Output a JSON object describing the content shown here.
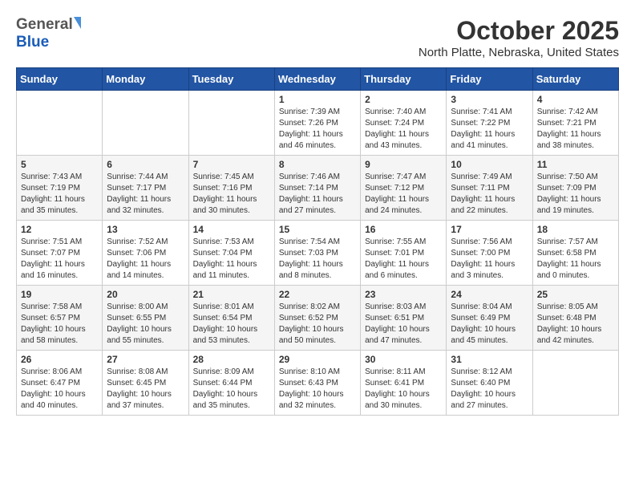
{
  "header": {
    "logo_general": "General",
    "logo_blue": "Blue",
    "title": "October 2025",
    "subtitle": "North Platte, Nebraska, United States"
  },
  "weekdays": [
    "Sunday",
    "Monday",
    "Tuesday",
    "Wednesday",
    "Thursday",
    "Friday",
    "Saturday"
  ],
  "weeks": [
    [
      {
        "day": "",
        "info": ""
      },
      {
        "day": "",
        "info": ""
      },
      {
        "day": "",
        "info": ""
      },
      {
        "day": "1",
        "info": "Sunrise: 7:39 AM\nSunset: 7:26 PM\nDaylight: 11 hours\nand 46 minutes."
      },
      {
        "day": "2",
        "info": "Sunrise: 7:40 AM\nSunset: 7:24 PM\nDaylight: 11 hours\nand 43 minutes."
      },
      {
        "day": "3",
        "info": "Sunrise: 7:41 AM\nSunset: 7:22 PM\nDaylight: 11 hours\nand 41 minutes."
      },
      {
        "day": "4",
        "info": "Sunrise: 7:42 AM\nSunset: 7:21 PM\nDaylight: 11 hours\nand 38 minutes."
      }
    ],
    [
      {
        "day": "5",
        "info": "Sunrise: 7:43 AM\nSunset: 7:19 PM\nDaylight: 11 hours\nand 35 minutes."
      },
      {
        "day": "6",
        "info": "Sunrise: 7:44 AM\nSunset: 7:17 PM\nDaylight: 11 hours\nand 32 minutes."
      },
      {
        "day": "7",
        "info": "Sunrise: 7:45 AM\nSunset: 7:16 PM\nDaylight: 11 hours\nand 30 minutes."
      },
      {
        "day": "8",
        "info": "Sunrise: 7:46 AM\nSunset: 7:14 PM\nDaylight: 11 hours\nand 27 minutes."
      },
      {
        "day": "9",
        "info": "Sunrise: 7:47 AM\nSunset: 7:12 PM\nDaylight: 11 hours\nand 24 minutes."
      },
      {
        "day": "10",
        "info": "Sunrise: 7:49 AM\nSunset: 7:11 PM\nDaylight: 11 hours\nand 22 minutes."
      },
      {
        "day": "11",
        "info": "Sunrise: 7:50 AM\nSunset: 7:09 PM\nDaylight: 11 hours\nand 19 minutes."
      }
    ],
    [
      {
        "day": "12",
        "info": "Sunrise: 7:51 AM\nSunset: 7:07 PM\nDaylight: 11 hours\nand 16 minutes."
      },
      {
        "day": "13",
        "info": "Sunrise: 7:52 AM\nSunset: 7:06 PM\nDaylight: 11 hours\nand 14 minutes."
      },
      {
        "day": "14",
        "info": "Sunrise: 7:53 AM\nSunset: 7:04 PM\nDaylight: 11 hours\nand 11 minutes."
      },
      {
        "day": "15",
        "info": "Sunrise: 7:54 AM\nSunset: 7:03 PM\nDaylight: 11 hours\nand 8 minutes."
      },
      {
        "day": "16",
        "info": "Sunrise: 7:55 AM\nSunset: 7:01 PM\nDaylight: 11 hours\nand 6 minutes."
      },
      {
        "day": "17",
        "info": "Sunrise: 7:56 AM\nSunset: 7:00 PM\nDaylight: 11 hours\nand 3 minutes."
      },
      {
        "day": "18",
        "info": "Sunrise: 7:57 AM\nSunset: 6:58 PM\nDaylight: 11 hours\nand 0 minutes."
      }
    ],
    [
      {
        "day": "19",
        "info": "Sunrise: 7:58 AM\nSunset: 6:57 PM\nDaylight: 10 hours\nand 58 minutes."
      },
      {
        "day": "20",
        "info": "Sunrise: 8:00 AM\nSunset: 6:55 PM\nDaylight: 10 hours\nand 55 minutes."
      },
      {
        "day": "21",
        "info": "Sunrise: 8:01 AM\nSunset: 6:54 PM\nDaylight: 10 hours\nand 53 minutes."
      },
      {
        "day": "22",
        "info": "Sunrise: 8:02 AM\nSunset: 6:52 PM\nDaylight: 10 hours\nand 50 minutes."
      },
      {
        "day": "23",
        "info": "Sunrise: 8:03 AM\nSunset: 6:51 PM\nDaylight: 10 hours\nand 47 minutes."
      },
      {
        "day": "24",
        "info": "Sunrise: 8:04 AM\nSunset: 6:49 PM\nDaylight: 10 hours\nand 45 minutes."
      },
      {
        "day": "25",
        "info": "Sunrise: 8:05 AM\nSunset: 6:48 PM\nDaylight: 10 hours\nand 42 minutes."
      }
    ],
    [
      {
        "day": "26",
        "info": "Sunrise: 8:06 AM\nSunset: 6:47 PM\nDaylight: 10 hours\nand 40 minutes."
      },
      {
        "day": "27",
        "info": "Sunrise: 8:08 AM\nSunset: 6:45 PM\nDaylight: 10 hours\nand 37 minutes."
      },
      {
        "day": "28",
        "info": "Sunrise: 8:09 AM\nSunset: 6:44 PM\nDaylight: 10 hours\nand 35 minutes."
      },
      {
        "day": "29",
        "info": "Sunrise: 8:10 AM\nSunset: 6:43 PM\nDaylight: 10 hours\nand 32 minutes."
      },
      {
        "day": "30",
        "info": "Sunrise: 8:11 AM\nSunset: 6:41 PM\nDaylight: 10 hours\nand 30 minutes."
      },
      {
        "day": "31",
        "info": "Sunrise: 8:12 AM\nSunset: 6:40 PM\nDaylight: 10 hours\nand 27 minutes."
      },
      {
        "day": "",
        "info": ""
      }
    ]
  ]
}
